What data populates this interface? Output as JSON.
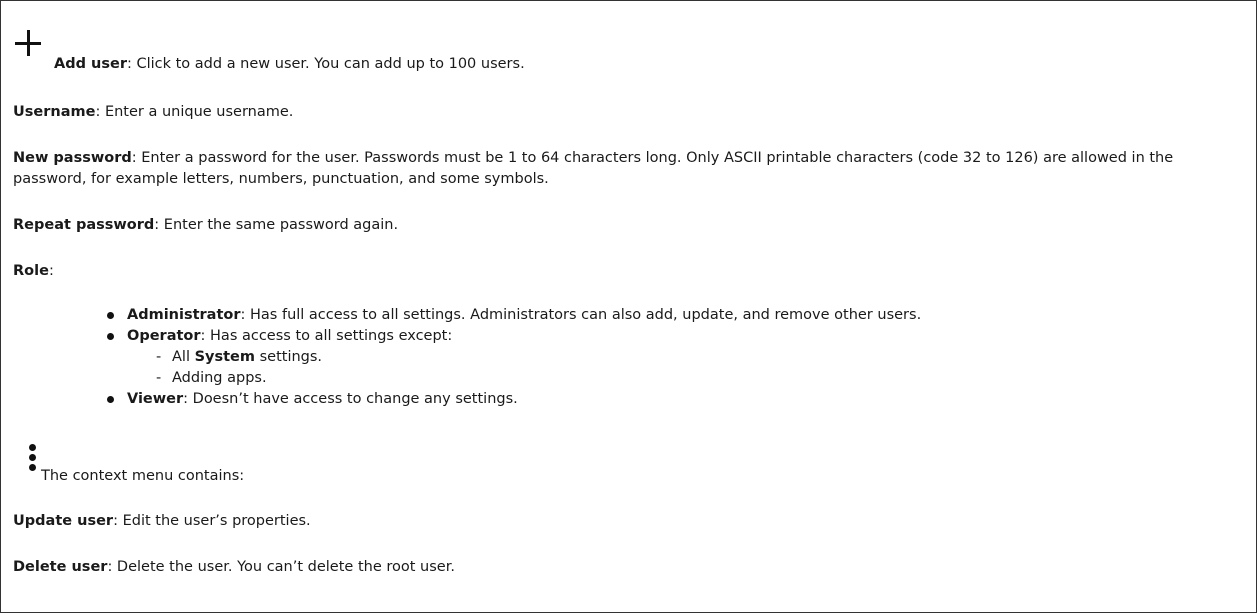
{
  "add_user": {
    "icon": "plus-icon",
    "term": "Add user",
    "desc": ": Click to add a new user. You can add up to 100 users."
  },
  "username": {
    "term": "Username",
    "desc": ": Enter a unique username."
  },
  "new_password": {
    "term": "New password",
    "desc": ": Enter a password for the user. Passwords must be 1 to 64 characters long. Only ASCII printable characters (code 32 to 126) are allowed in the password, for example letters, numbers, punctuation, and some symbols."
  },
  "repeat_password": {
    "term": "Repeat password",
    "desc": ": Enter the same password again."
  },
  "role": {
    "term": "Role",
    "suffix": ":",
    "items": [
      {
        "term": "Administrator",
        "desc": ": Has full access to all settings. Administrators can also add, update, and remove other users."
      },
      {
        "term": "Operator",
        "desc": ": Has access to all settings except:"
      },
      {
        "term": "Viewer",
        "desc": ": Doesn’t have access to change any settings."
      }
    ],
    "operator_exceptions": [
      {
        "prefix": "All ",
        "strong": "System",
        "suffix": " settings."
      },
      {
        "text": "Adding apps."
      }
    ],
    "dash": "-"
  },
  "context_menu": {
    "icon": "more-vertical-icon",
    "text": "The context menu contains:"
  },
  "update_user": {
    "term": "Update user",
    "desc": ": Edit the user’s properties."
  },
  "delete_user": {
    "term": "Delete user",
    "desc": ": Delete the user. You can’t delete the root user."
  }
}
